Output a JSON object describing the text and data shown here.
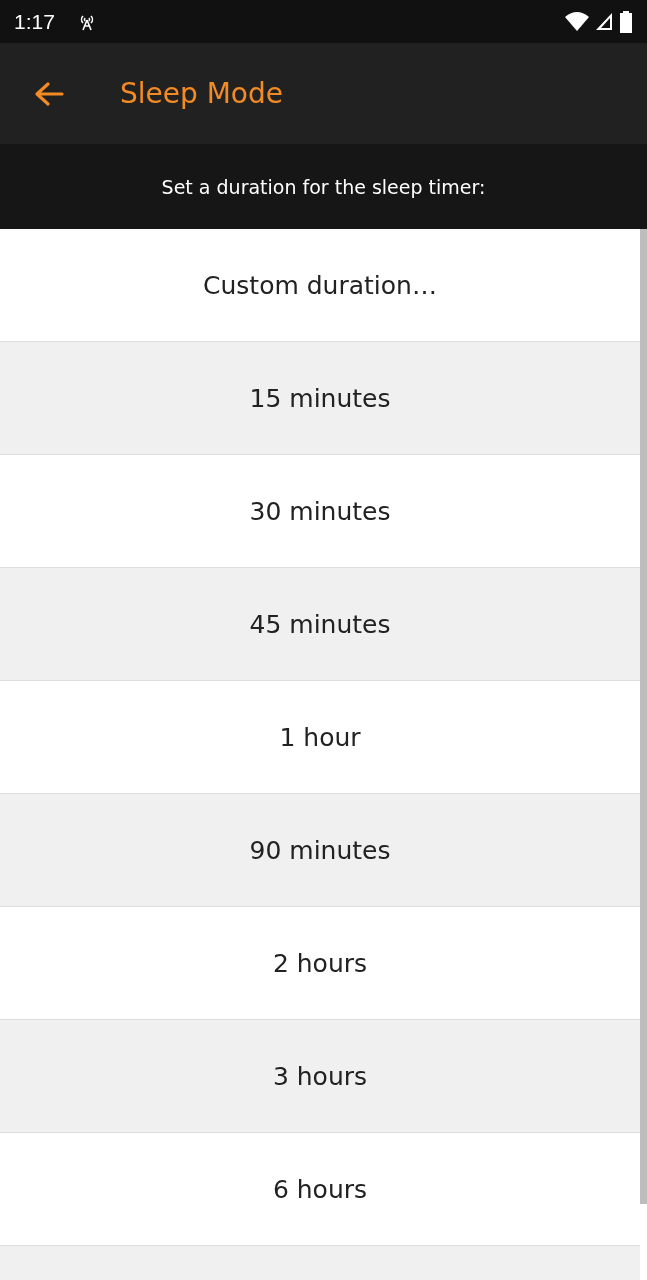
{
  "status_bar": {
    "time": "1:17"
  },
  "toolbar": {
    "title": "Sleep Mode"
  },
  "subtitle": "Set a duration for the sleep timer:",
  "options": [
    {
      "label": "Custom duration…"
    },
    {
      "label": "15 minutes"
    },
    {
      "label": "30 minutes"
    },
    {
      "label": "45 minutes"
    },
    {
      "label": "1 hour"
    },
    {
      "label": "90 minutes"
    },
    {
      "label": "2 hours"
    },
    {
      "label": "3 hours"
    },
    {
      "label": "6 hours"
    }
  ]
}
